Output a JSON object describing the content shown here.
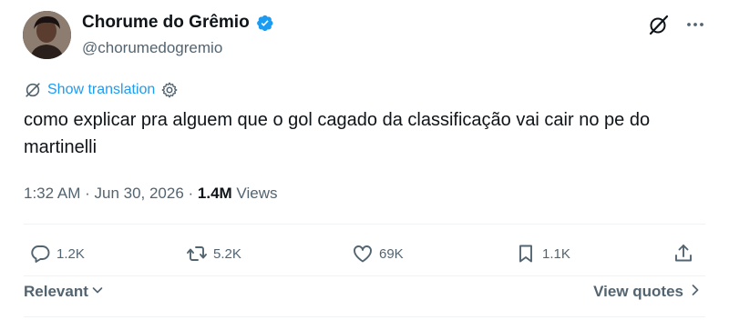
{
  "author": {
    "display_name": "Chorume do Grêmio",
    "handle": "@chorumedogremio",
    "verified": true
  },
  "translate": {
    "label": "Show translation"
  },
  "tweet": {
    "text": "como explicar pra alguem que o gol cagado da classificação vai cair no pe do martinelli"
  },
  "meta": {
    "time": "1:32 AM",
    "separator1": " · ",
    "date": "Jun 30, 2026",
    "separator2": " · ",
    "views_count": "1.4M",
    "views_label": " Views"
  },
  "actions": {
    "replies": "1.2K",
    "retweets": "5.2K",
    "likes": "69K",
    "bookmarks": "1.1K"
  },
  "footer": {
    "sort_label": "Relevant",
    "view_quotes_label": "View quotes"
  },
  "colors": {
    "accent": "#1d9bf0",
    "text": "#0f1419",
    "secondary": "#536471",
    "divider": "#eff3f4"
  },
  "icons": {
    "verified": "verified-badge-icon",
    "grok": "grok-icon",
    "more": "more-horizontal-icon",
    "translate": "translate-icon",
    "settings": "gear-icon",
    "reply": "reply-icon",
    "retweet": "retweet-icon",
    "like": "heart-icon",
    "bookmark": "bookmark-icon",
    "share": "share-icon"
  }
}
